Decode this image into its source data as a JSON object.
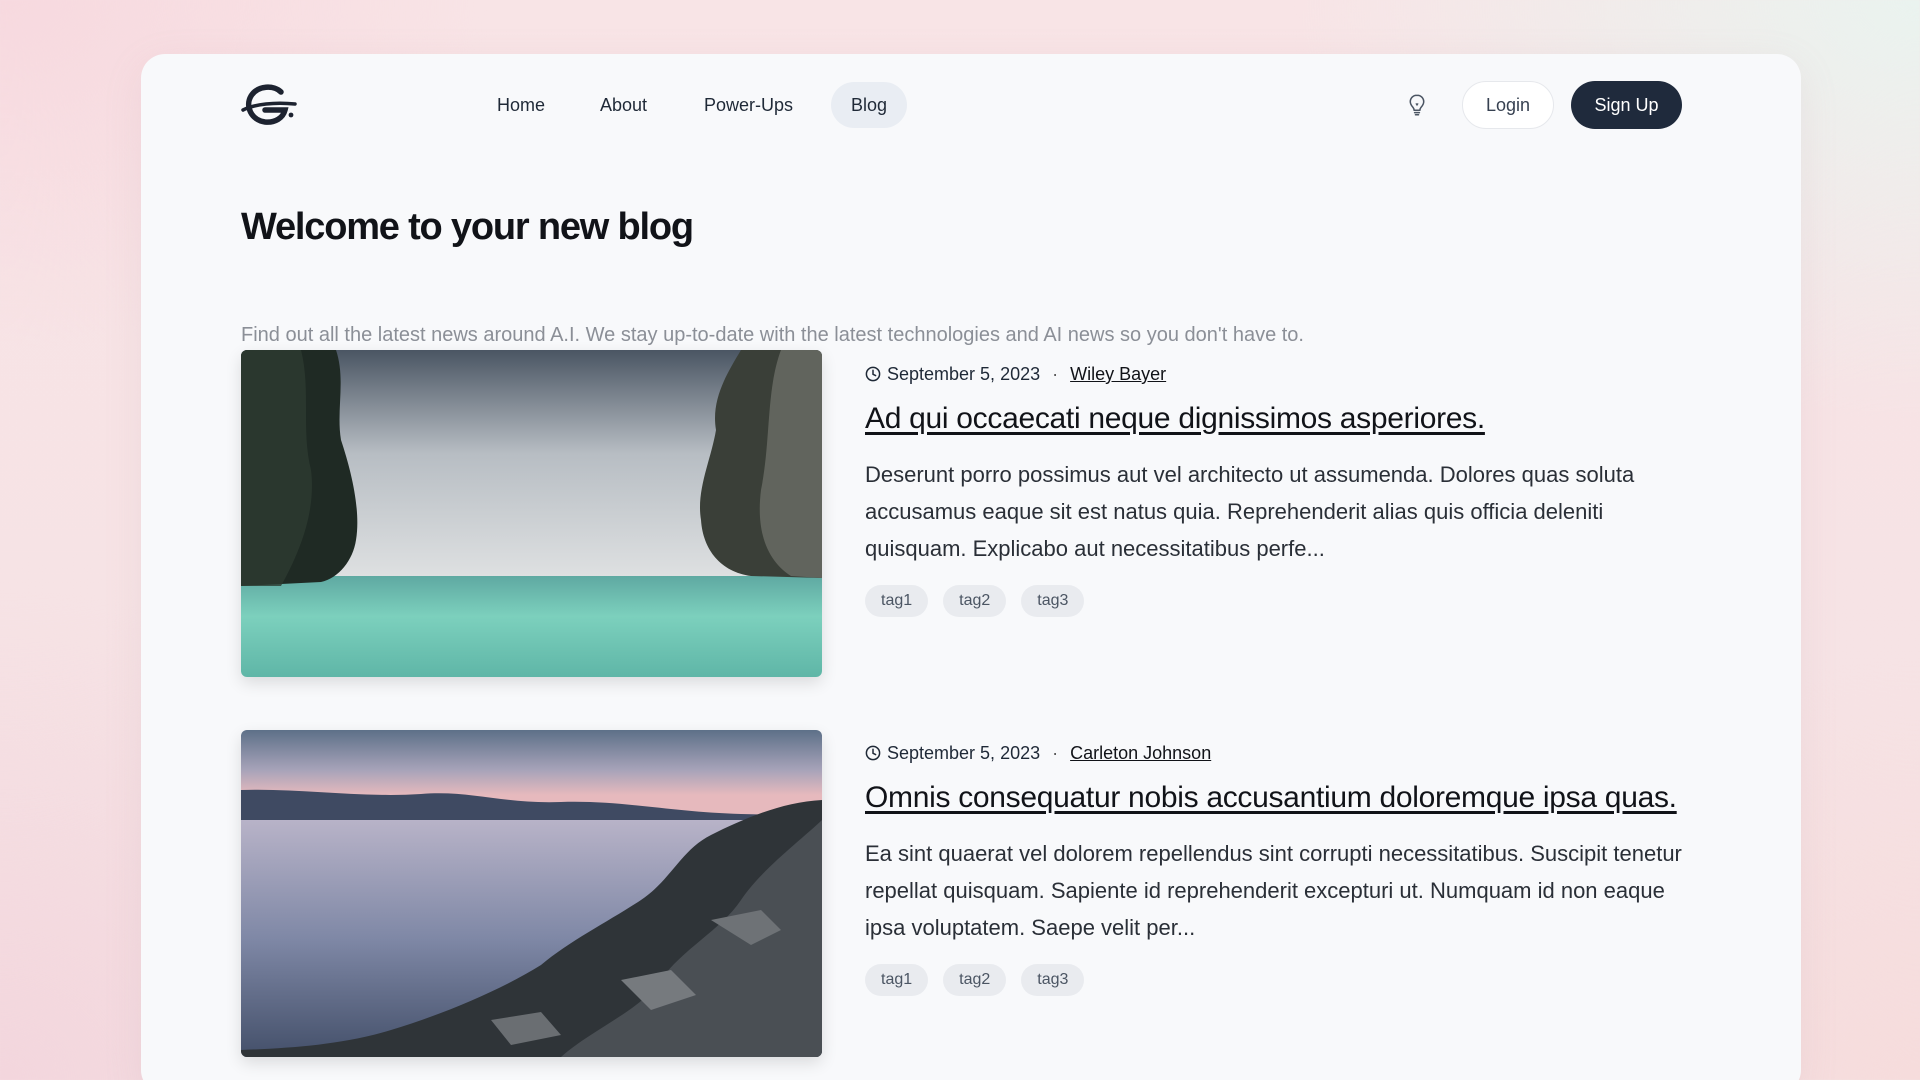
{
  "nav": {
    "links": [
      {
        "label": "Home"
      },
      {
        "label": "About"
      },
      {
        "label": "Power-Ups"
      },
      {
        "label": "Blog"
      }
    ],
    "active": "Blog",
    "login_label": "Login",
    "signup_label": "Sign Up",
    "icons": [
      "logo",
      "lightbulb-icon"
    ]
  },
  "hero": {
    "title": "Welcome to your new blog",
    "subtitle": "Find out all the latest news around A.I. We stay up-to-date with the latest technologies and AI news so you don't have to."
  },
  "posts": [
    {
      "date": "September 5, 2023",
      "author": "Wiley Bayer",
      "title": "Ad qui occaecati neque dignissimos asperiores.",
      "excerpt": "Deserunt porro possimus aut vel architecto ut assumenda. Dolores quas soluta accusamus eaque sit est natus quia. Reprehenderit alias quis officia deleniti quisquam. Explicabo aut necessitatibus perfe...",
      "tags": [
        "tag1",
        "tag2",
        "tag3"
      ],
      "image": "sea between two cliffs"
    },
    {
      "date": "September 5, 2023",
      "author": "Carleton Johnson",
      "title": "Omnis consequatur nobis accusantium doloremque ipsa quas.",
      "excerpt": "Ea sint quaerat vel dolorem repellendus sint corrupti necessitatibus. Suscipit tenetur repellat quisquam. Sapiente id reprehenderit excepturi ut. Numquam id non eaque ipsa voluptatem. Saepe velit per...",
      "tags": [
        "tag1",
        "tag2",
        "tag3"
      ],
      "image": "rocky coastline at sunset"
    }
  ],
  "colors": {
    "accent_dark": "#1f2a3c",
    "card_bg": "#f8f9fb",
    "tag_bg": "#e9ebef"
  }
}
